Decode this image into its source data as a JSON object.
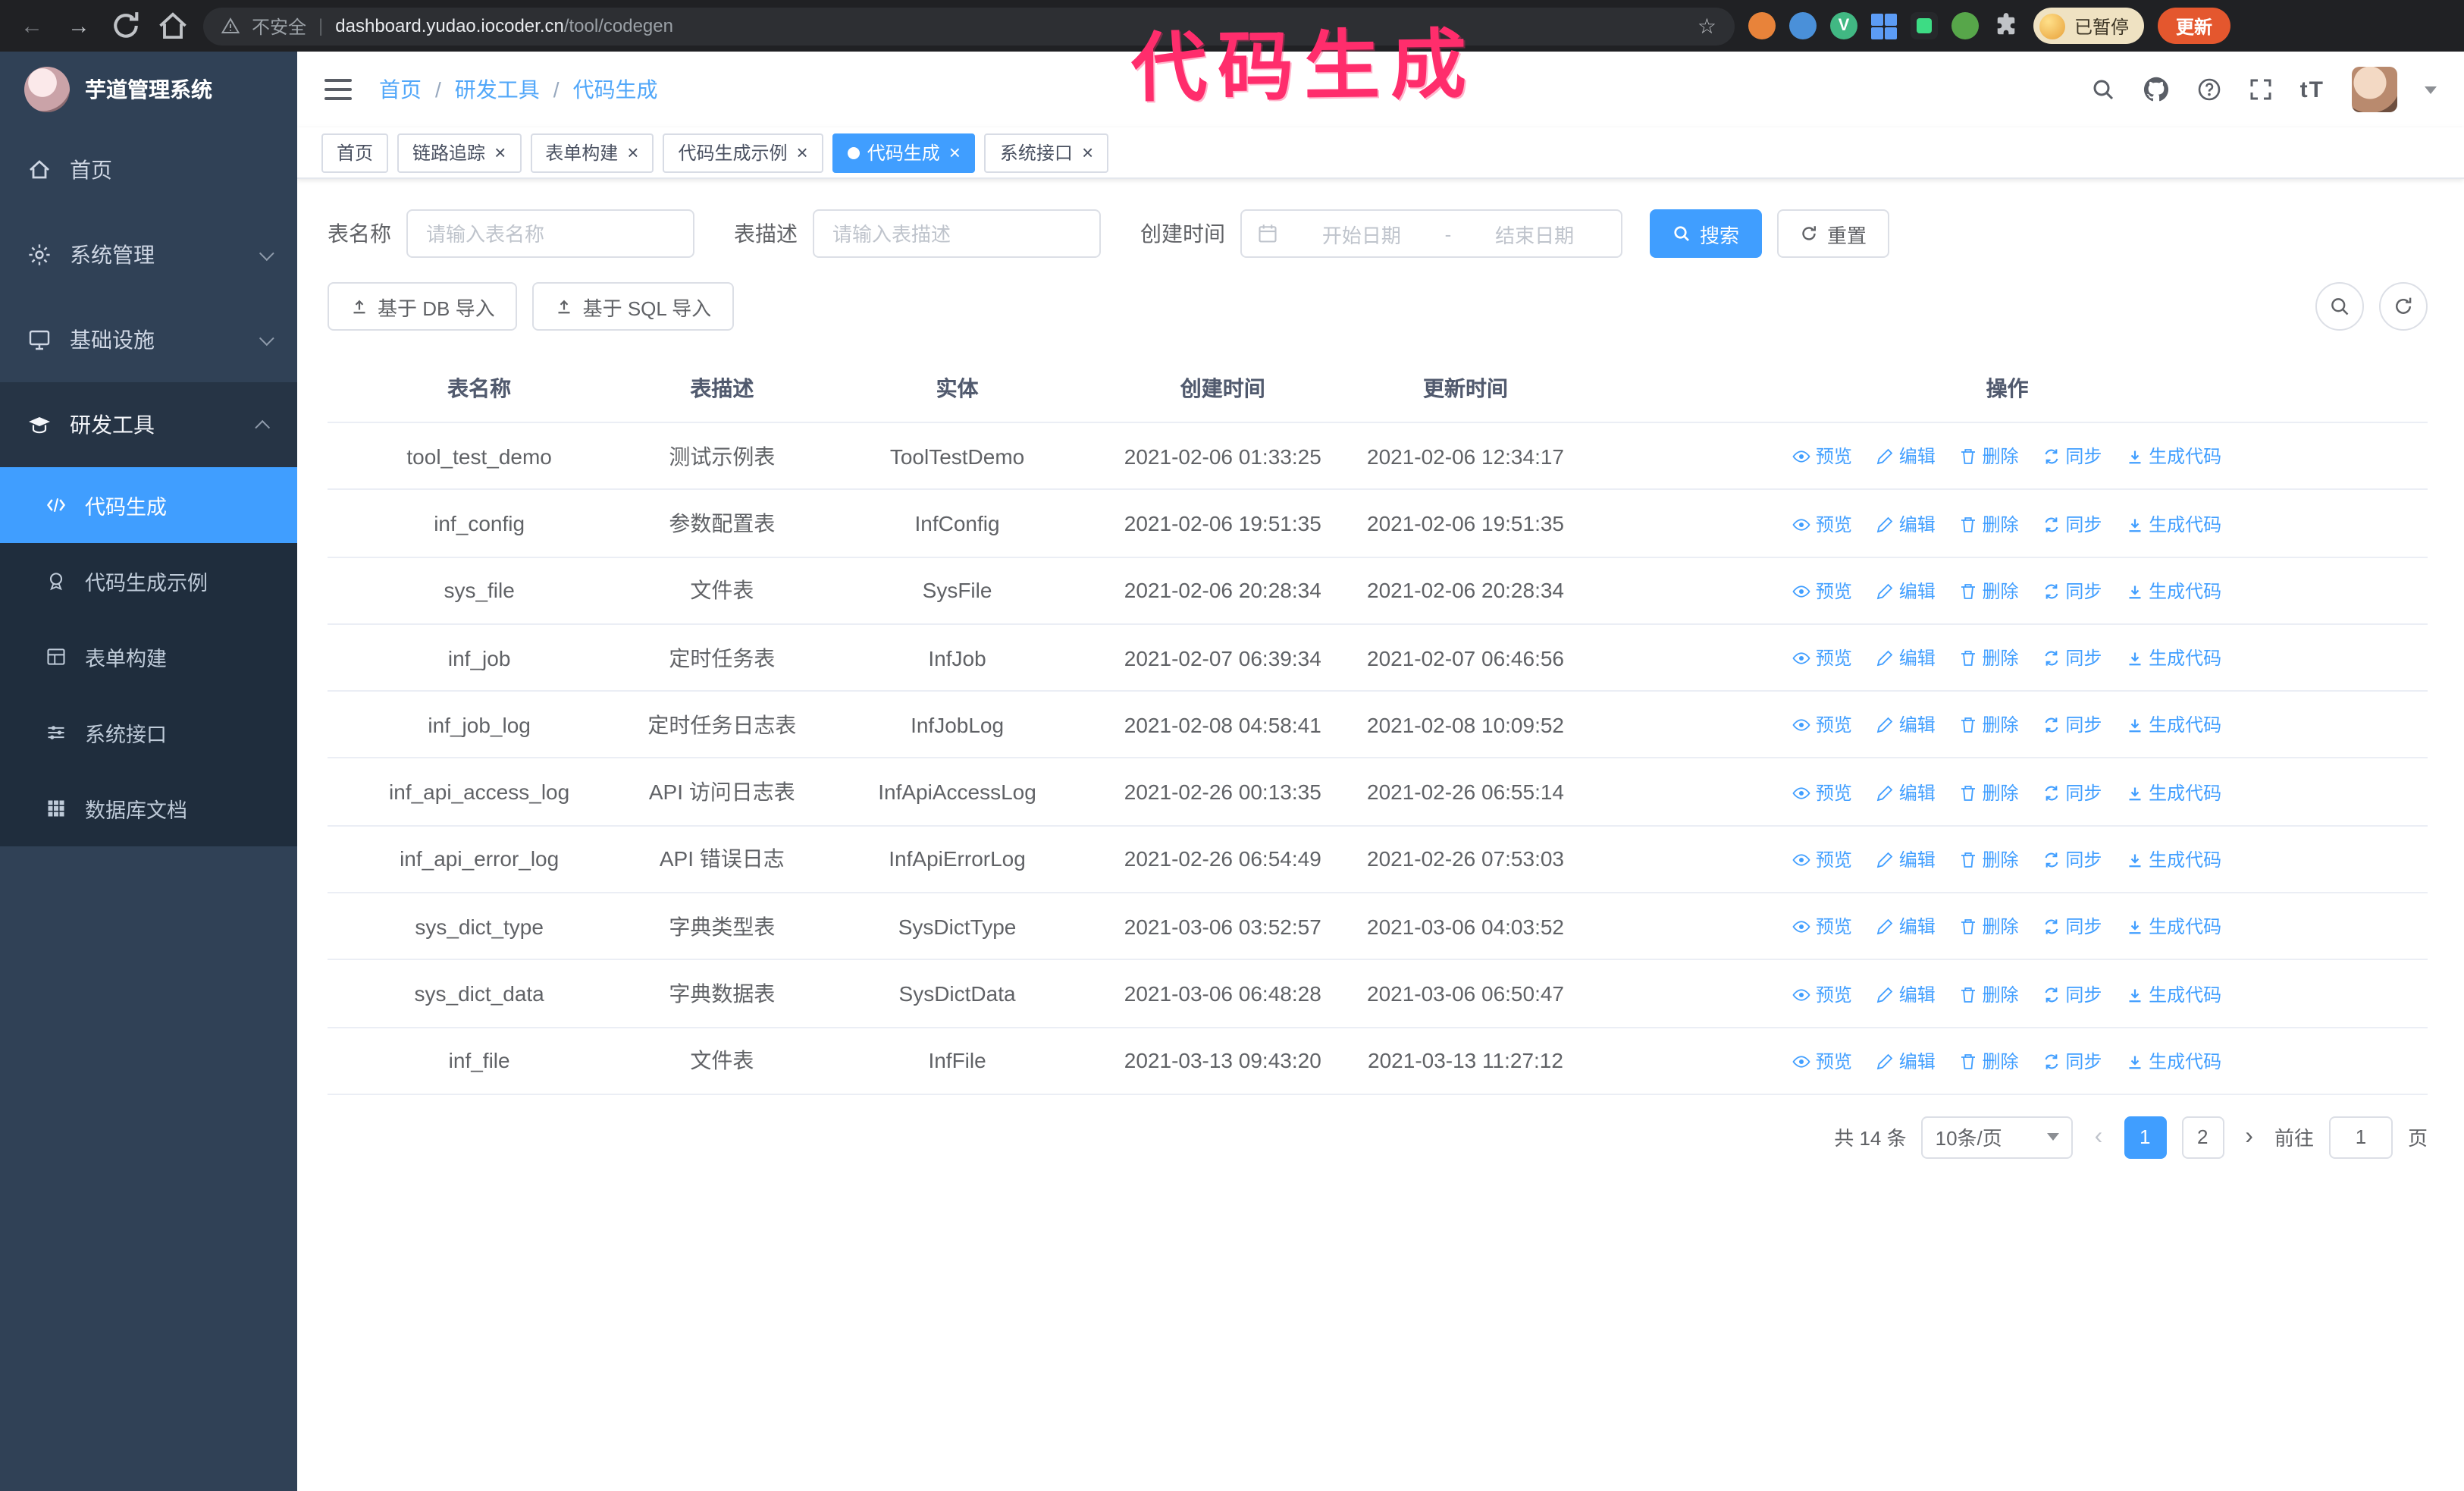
{
  "annotation": {
    "text": "代码生成",
    "color": "#ff2d6c"
  },
  "colors": {
    "accent": "#409eff",
    "sidebar_bg": "#304156",
    "submenu_bg": "#1f2d3d",
    "update_button_bg": "#e4572e"
  },
  "icons": {
    "back": "←",
    "forward": "→",
    "star": "☆",
    "close": "×",
    "prev": "‹",
    "next": "›",
    "font_size": "tT",
    "vue_v": "V",
    "warning": "⚠"
  },
  "browser": {
    "security_label": "不安全",
    "url_host": "dashboard.yudao.iocoder.cn",
    "url_path": "/tool/codegen",
    "profile_badge": "已暂停",
    "update_button": "更新"
  },
  "sidebar": {
    "logo_title": "芋道管理系统",
    "items": {
      "home": "首页",
      "system": "系统管理",
      "infra": "基础设施",
      "devtools": "研发工具"
    },
    "subitems": {
      "codegen": "代码生成",
      "codegen_example": "代码生成示例",
      "form_builder": "表单构建",
      "api": "系统接口",
      "db_doc": "数据库文档"
    }
  },
  "header": {
    "breadcrumb": [
      "首页",
      "研发工具",
      "代码生成"
    ]
  },
  "tabs": [
    {
      "label": "首页",
      "closable": false
    },
    {
      "label": "链路追踪",
      "closable": true
    },
    {
      "label": "表单构建",
      "closable": true
    },
    {
      "label": "代码生成示例",
      "closable": true
    },
    {
      "label": "代码生成",
      "closable": true,
      "active": true
    },
    {
      "label": "系统接口",
      "closable": true
    }
  ],
  "filters": {
    "table_name_label": "表名称",
    "table_name_placeholder": "请输入表名称",
    "table_desc_label": "表描述",
    "table_desc_placeholder": "请输入表描述",
    "create_time_label": "创建时间",
    "date_start_placeholder": "开始日期",
    "date_separator": "-",
    "date_end_placeholder": "结束日期",
    "search_button": "搜索",
    "reset_button": "重置"
  },
  "toolbar": {
    "import_db_button": "基于 DB 导入",
    "import_sql_button": "基于 SQL 导入"
  },
  "table": {
    "columns": [
      "表名称",
      "表描述",
      "实体",
      "创建时间",
      "更新时间",
      "操作"
    ],
    "actions": [
      "预览",
      "编辑",
      "删除",
      "同步",
      "生成代码"
    ],
    "rows": [
      {
        "name": "tool_test_demo",
        "desc": "测试示例表",
        "entity": "ToolTestDemo",
        "created": "2021-02-06 01:33:25",
        "updated": "2021-02-06 12:34:17"
      },
      {
        "name": "inf_config",
        "desc": "参数配置表",
        "entity": "InfConfig",
        "created": "2021-02-06 19:51:35",
        "updated": "2021-02-06 19:51:35"
      },
      {
        "name": "sys_file",
        "desc": "文件表",
        "entity": "SysFile",
        "created": "2021-02-06 20:28:34",
        "updated": "2021-02-06 20:28:34"
      },
      {
        "name": "inf_job",
        "desc": "定时任务表",
        "entity": "InfJob",
        "created": "2021-02-07 06:39:34",
        "updated": "2021-02-07 06:46:56"
      },
      {
        "name": "inf_job_log",
        "desc": "定时任务日志表",
        "entity": "InfJobLog",
        "created": "2021-02-08 04:58:41",
        "updated": "2021-02-08 10:09:52"
      },
      {
        "name": "inf_api_access_log",
        "desc": "API 访问日志表",
        "entity": "InfApiAccessLog",
        "created": "2021-02-26 00:13:35",
        "updated": "2021-02-26 06:55:14"
      },
      {
        "name": "inf_api_error_log",
        "desc": "API 错误日志",
        "entity": "InfApiErrorLog",
        "created": "2021-02-26 06:54:49",
        "updated": "2021-02-26 07:53:03"
      },
      {
        "name": "sys_dict_type",
        "desc": "字典类型表",
        "entity": "SysDictType",
        "created": "2021-03-06 03:52:57",
        "updated": "2021-03-06 04:03:52"
      },
      {
        "name": "sys_dict_data",
        "desc": "字典数据表",
        "entity": "SysDictData",
        "created": "2021-03-06 06:48:28",
        "updated": "2021-03-06 06:50:47"
      },
      {
        "name": "inf_file",
        "desc": "文件表",
        "entity": "InfFile",
        "created": "2021-03-13 09:43:20",
        "updated": "2021-03-13 11:27:12"
      }
    ]
  },
  "pagination": {
    "total_text": "共 14 条",
    "page_size": "10条/页",
    "pages": [
      "1",
      "2"
    ],
    "active_page": "1",
    "goto_label": "前往",
    "goto_value": "1",
    "goto_suffix": "页"
  }
}
